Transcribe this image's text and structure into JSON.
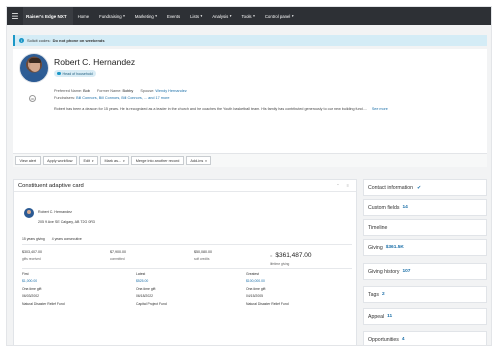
{
  "nav": {
    "brand": "Raiser's Edge NXT",
    "items": [
      "Home",
      "Fundraising",
      "Marketing",
      "Events",
      "Lists",
      "Analysis",
      "Tools",
      "Control panel"
    ],
    "carets": [
      "",
      "▾",
      "▾",
      "",
      "▾",
      "▾",
      "▾",
      "▾"
    ]
  },
  "alert": {
    "text": "Solicit codes:",
    "bold": "Do not phone on weekends"
  },
  "profile": {
    "name": "Robert C. Hernandez",
    "badge": "Head of household",
    "preferred_label": "Preferred Name:",
    "preferred_value": "Bob",
    "former_label": "Former Name:",
    "former_value": "Bobby",
    "spouse_label": "Spouse:",
    "spouse_value": "Wendy Hernandez",
    "fundraisers_label": "Fundraisers:",
    "fundraisers_value": "Bill Connors, Bill Connors, Bill Connors, ... and 17 more",
    "bio": "Robert has been a deacon for 15 years. He is recognized as a leader in the church and he coaches the Youth basketball team. His family has contributed generously to our new building fund....",
    "see_more": "See more"
  },
  "toolbar": {
    "buttons": [
      "View alert",
      "Apply workflow",
      "Edit",
      "Mark as...",
      "Merge into another record",
      "Add-ins"
    ],
    "has_caret": [
      false,
      false,
      true,
      true,
      false,
      true
    ]
  },
  "adaptive_card": {
    "title": "Constituent adaptive card",
    "name": "Robert C. Hernandez",
    "address": "205 9 Ave SE Calgary, AB T2G 0R3",
    "years_giving": "15 years giving",
    "years_consecutive": "4 years consecutive",
    "stats": [
      {
        "value": "$303,407.00",
        "label": "gifts received"
      },
      {
        "value": "$7,900.00",
        "label": "committed"
      },
      {
        "value": "$50,080.00",
        "label": "soft credits"
      }
    ],
    "lifetime": {
      "eq": "=",
      "value": "$361,487.00",
      "label": "lifetime giving"
    },
    "gifts": [
      {
        "heading": "First",
        "amount": "$1,000.00",
        "type": "One-time gift",
        "date": "06/03/2002",
        "fund": "Natural Disaster Relief Fund"
      },
      {
        "heading": "Latest",
        "amount": "$525.00",
        "type": "One-time gift",
        "date": "06/18/2022",
        "fund": "Capital Project Fund"
      },
      {
        "heading": "Greatest",
        "amount": "$100,000.00",
        "type": "One-time gift",
        "date": "04/15/2005",
        "fund": "Natural Disaster Relief Fund"
      }
    ]
  },
  "sidebar": [
    {
      "label": "Contact information",
      "count": "",
      "check": "✔"
    },
    {
      "label": "Custom fields",
      "count": "14",
      "check": ""
    },
    {
      "label": "Timeline",
      "count": "",
      "check": ""
    },
    {
      "label": "Giving",
      "count": "$361.5K",
      "check": ""
    },
    {
      "label": "Giving history",
      "count": "107",
      "check": ""
    },
    {
      "label": "Tags",
      "count": "2",
      "check": ""
    },
    {
      "label": "Appeal",
      "count": "11",
      "check": ""
    },
    {
      "label": "Opportunities",
      "count": "4",
      "check": ""
    }
  ],
  "colors": {
    "nav_bg": "#2d3035",
    "accent": "#1b97c7",
    "link": "#1b6fa8",
    "alert_bg": "#d4ecf6"
  }
}
